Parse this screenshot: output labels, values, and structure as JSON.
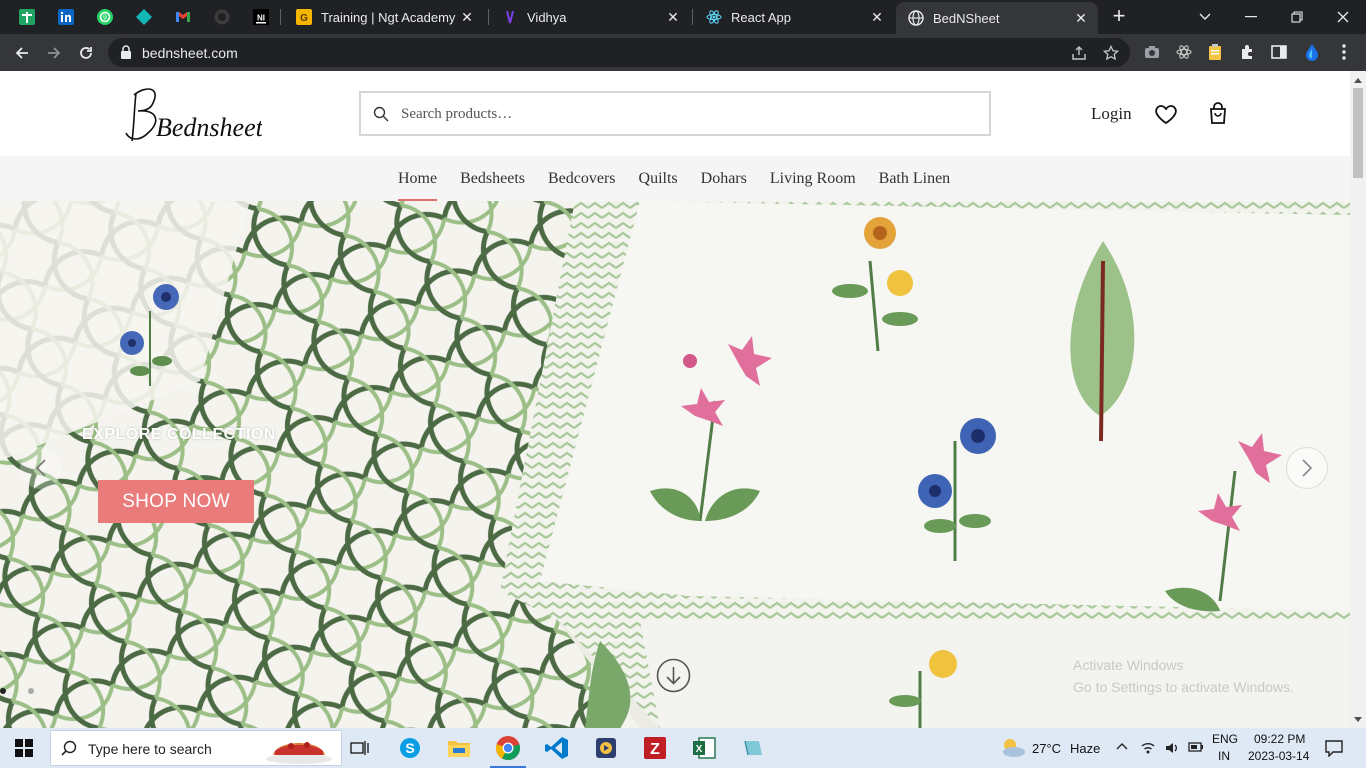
{
  "browser": {
    "tabs": [
      {
        "title": "Training | Ngt Academy"
      },
      {
        "title": "Vidhya"
      },
      {
        "title": "React App"
      },
      {
        "title": "BedNSheet",
        "active": true
      }
    ],
    "close_glyph": "✕",
    "new_tab_glyph": "+",
    "url": "bednsheet.com"
  },
  "site": {
    "logo_text": "Bednsheet",
    "search_placeholder": "Search products…",
    "login_label": "Login",
    "nav": [
      "Home",
      "Bedsheets",
      "Bedcovers",
      "Quilts",
      "Dohars",
      "Living Room",
      "Bath Linen"
    ],
    "active_nav": "Home",
    "accent_color": "#ea7b7b",
    "hero": {
      "kicker": "EXPLORE COLLECTION",
      "button_label": "SHOP NOW",
      "slide_count": 2,
      "active_slide": 1
    },
    "watermark": [
      "Activate Windows",
      "Go to Settings to activate Windows."
    ]
  },
  "taskbar": {
    "search_text": "Type here to search",
    "weather_temp": "27°C",
    "weather_desc": "Haze",
    "lang_line1": "ENG",
    "lang_line2": "IN",
    "time": "09:22 PM",
    "date": "2023-03-14"
  }
}
